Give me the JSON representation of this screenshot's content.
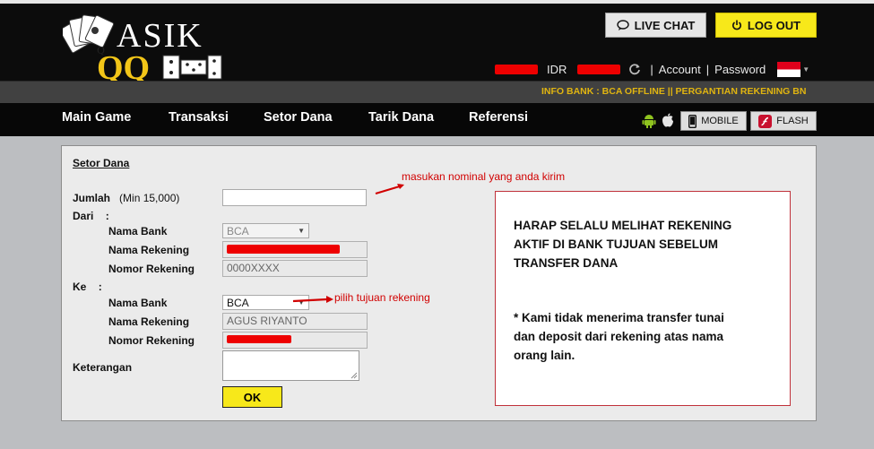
{
  "brand": {
    "logo_text": "ASIK QQ"
  },
  "header": {
    "live_chat_label": "LIVE CHAT",
    "logout_label": "LOG OUT",
    "currency": "IDR",
    "separator": "|",
    "account_label": "Account",
    "password_label": "Password"
  },
  "ticker": {
    "text": "INFO BANK : BCA OFFLINE || PERGANTIAN REKENING BN"
  },
  "nav": {
    "items": [
      "Main Game",
      "Transaksi",
      "Setor Dana",
      "Tarik Dana",
      "Referensi"
    ],
    "mobile_label": "MOBILE",
    "flash_label": "FLASH"
  },
  "form": {
    "title": "Setor Dana",
    "jumlah_label": "Jumlah",
    "jumlah_note": "(Min 15,000)",
    "jumlah_value": "",
    "dari_label": "Dari",
    "ke_label": "Ke",
    "colon": ":",
    "nama_bank_label": "Nama Bank",
    "nama_rekening_label": "Nama Rekening",
    "nomor_rekening_label": "Nomor Rekening",
    "from": {
      "bank": "BCA",
      "account_number": "0000XXXX"
    },
    "to": {
      "bank": "BCA",
      "account_name": "AGUS RIYANTO"
    },
    "keterangan_label": "Keterangan",
    "submit_label": "OK"
  },
  "annotations": {
    "nominal": "masukan nominal yang anda kirim",
    "tujuan": "pilih tujuan rekening"
  },
  "notice": {
    "line1": "HARAP SELALU MELIHAT REKENING",
    "line2": "AKTIF DI BANK TUJUAN SEBELUM",
    "line3": "TRANSFER DANA",
    "line4": "* Kami tidak menerima transfer tunai",
    "line5": "dan deposit dari rekening atas nama",
    "line6": "orang lain."
  },
  "colors": {
    "accent_yellow": "#f7e81a",
    "ticker_gold": "#e1b510",
    "annotation_red": "#d10000",
    "notice_border": "#c0313a"
  }
}
